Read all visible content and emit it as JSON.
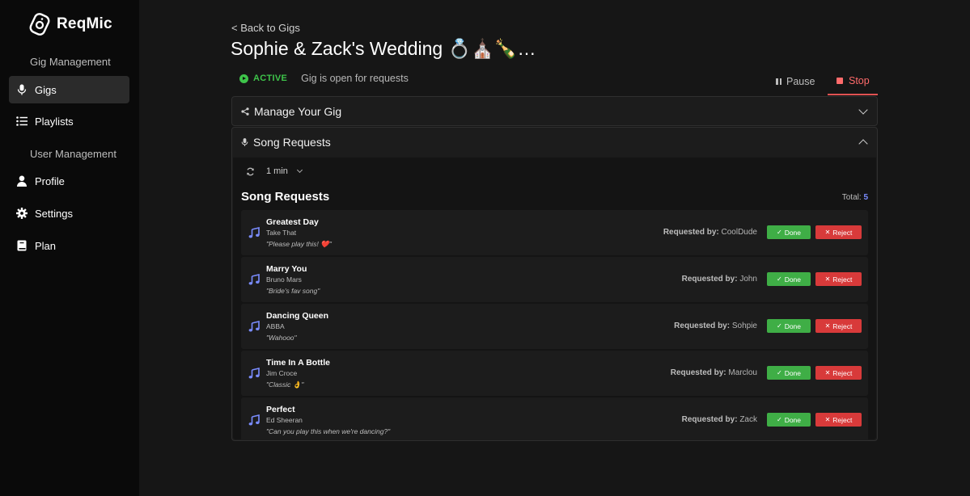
{
  "brand": {
    "name": "ReqMic"
  },
  "sidebar": {
    "sections": [
      {
        "title": "Gig Management"
      },
      {
        "title": "User Management"
      }
    ],
    "items": [
      {
        "label": "Gigs",
        "icon": "microphone-icon",
        "active": true
      },
      {
        "label": "Playlists",
        "icon": "list-icon"
      },
      {
        "label": "Profile",
        "icon": "user-icon"
      },
      {
        "label": "Settings",
        "icon": "gear-icon"
      },
      {
        "label": "Plan",
        "icon": "book-icon"
      }
    ]
  },
  "header": {
    "back_label": "< Back to Gigs",
    "title": "Sophie & Zack's Wedding 💍⛪🍾…"
  },
  "status": {
    "label": "ACTIVE",
    "text": "Gig is open for requests",
    "color": "#3ec44a"
  },
  "controls": {
    "pause_label": "Pause",
    "stop_label": "Stop"
  },
  "manage_panel": {
    "title": "Manage Your Gig"
  },
  "requests_panel": {
    "title": "Song Requests",
    "refresh_interval": "1 min",
    "heading": "Song Requests",
    "total_label": "Total:",
    "total_count": "5",
    "requested_by_label": "Requested by:",
    "done_label": "Done",
    "reject_label": "Reject",
    "requests": [
      {
        "song": "Greatest Day",
        "artist": "Take That",
        "note": "\"Please play this! ❤️\"",
        "requester": "CoolDude"
      },
      {
        "song": "Marry You",
        "artist": "Bruno Mars",
        "note": "\"Bride's fav song\"",
        "requester": "John"
      },
      {
        "song": "Dancing Queen",
        "artist": "ABBA",
        "note": "\"Wahooo\"",
        "requester": "Sohpie"
      },
      {
        "song": "Time In A Bottle",
        "artist": "Jim Croce",
        "note": "\"Classic 👌\"",
        "requester": "Marclou"
      },
      {
        "song": "Perfect",
        "artist": "Ed Sheeran",
        "note": "\"Can you play this when we're dancing?\"",
        "requester": "Zack"
      }
    ]
  },
  "colors": {
    "accent_blue": "#7a8cff",
    "done_green": "#3fae46",
    "reject_red": "#d83a3a",
    "stop_red": "#ff6b6b"
  }
}
